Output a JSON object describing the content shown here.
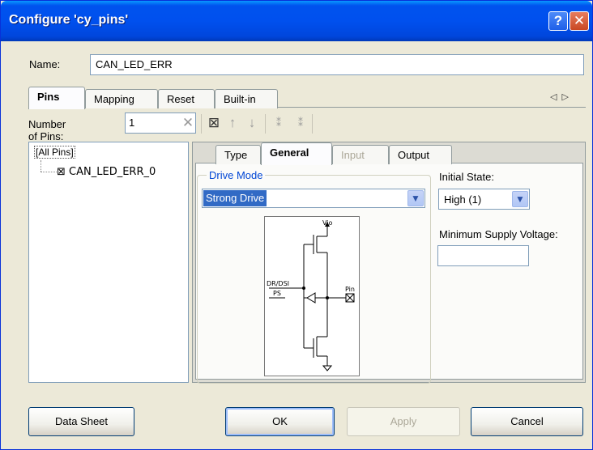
{
  "window": {
    "title": "Configure 'cy_pins'",
    "help_label": "?",
    "close_label": "✕"
  },
  "name": {
    "label": "Name:",
    "value": "CAN_LED_ERR"
  },
  "top_tabs": [
    "Pins",
    "Mapping",
    "Reset",
    "Built-in"
  ],
  "tab_scroll": {
    "left": "◁",
    "right": "▷"
  },
  "toolbar": {
    "pins_label": "Number of Pins:",
    "pins_value": "1",
    "icons": [
      "delete-icon",
      "add-pin-icon",
      "move-up-icon",
      "move-down-icon",
      "split-icon",
      "merge-icon"
    ]
  },
  "tree": {
    "root": "[All Pins]",
    "items": [
      "CAN_LED_ERR_0"
    ]
  },
  "inner_tabs": [
    "Type",
    "General",
    "Input",
    "Output"
  ],
  "general": {
    "drive_mode_label": "Drive Mode",
    "drive_mode_value": "Strong Drive",
    "initial_state_label": "Initial State:",
    "initial_state_value": "High (1)",
    "min_supply_label": "Minimum Supply Voltage:",
    "min_supply_value": ""
  },
  "diagram": {
    "vdd": "Vio",
    "dr": "DR/DSI",
    "ps": "PS",
    "pin": "Pin"
  },
  "buttons": {
    "datasheet": "Data Sheet",
    "ok": "OK",
    "apply": "Apply",
    "cancel": "Cancel"
  },
  "colors": {
    "title_bar": "#0053ee",
    "accent": "#316ac5",
    "group_label": "#0046d5"
  }
}
